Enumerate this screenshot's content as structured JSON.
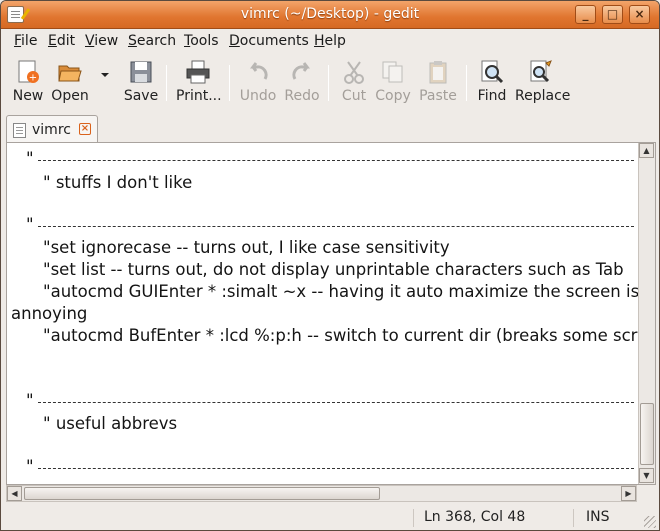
{
  "window": {
    "title": "vimrc (~/Desktop) - gedit"
  },
  "window_buttons": {
    "minimize": "_",
    "maximize": "□",
    "close": "×"
  },
  "menu": [
    {
      "label": "File",
      "mnemonic": "F",
      "rest": "ile"
    },
    {
      "label": "Edit",
      "mnemonic": "E",
      "rest": "dit"
    },
    {
      "label": "View",
      "mnemonic": "V",
      "rest": "iew"
    },
    {
      "label": "Search",
      "mnemonic": "S",
      "rest": "earch"
    },
    {
      "label": "Tools",
      "mnemonic": "T",
      "rest": "ools"
    },
    {
      "label": "Documents",
      "mnemonic": "D",
      "rest": "ocuments"
    },
    {
      "label": "Help",
      "mnemonic": "H",
      "rest": "elp"
    }
  ],
  "toolbar": {
    "new": "New",
    "open": "Open",
    "save": "Save",
    "print": "Print...",
    "undo": "Undo",
    "redo": "Redo",
    "cut": "Cut",
    "copy": "Copy",
    "paste": "Paste",
    "find": "Find",
    "replace": "Replace"
  },
  "tab": {
    "label": "vimrc"
  },
  "editor": {
    "lines": [
      "\"",
      "\" stuffs I don't like",
      "\"",
      "\"set ignorecase -- turns out, I like case sensitivity",
      "\"set list -- turns out, do not display unprintable characters such as Tab",
      "\"autocmd GUIEnter * :simalt ~x -- having it auto maximize the screen is",
      "annoying",
      "\"autocmd BufEnter * :lcd %:p:h -- switch to current dir (breaks some scripts)",
      "\"",
      "\" useful abbrevs",
      "\""
    ]
  },
  "status": {
    "position": "Ln 368, Col 48",
    "mode": "INS"
  }
}
